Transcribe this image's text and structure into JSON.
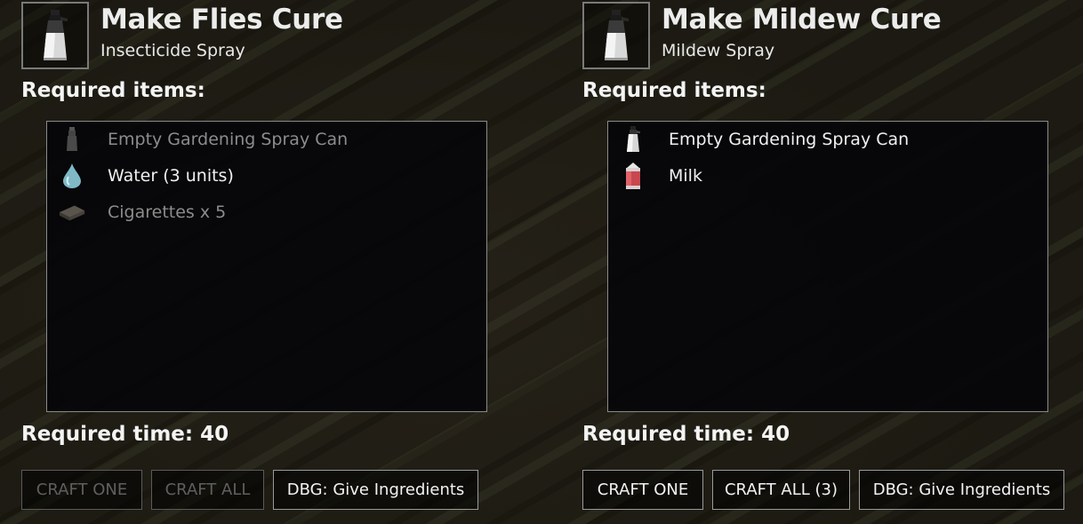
{
  "recipes": [
    {
      "title": "Make Flies Cure",
      "subtitle": "Insecticide Spray",
      "required_items_label": "Required items:",
      "items": [
        {
          "label": "Empty Gardening Spray Can",
          "icon": "spray-can-icon",
          "available": false
        },
        {
          "label": "Water (3 units)",
          "icon": "water-drop-icon",
          "available": true
        },
        {
          "label": "Cigarettes x 5",
          "icon": "cigarettes-icon",
          "available": false
        }
      ],
      "required_time_label": "Required time:",
      "required_time": "40",
      "buttons": {
        "craft_one": "CRAFT ONE",
        "craft_all": "CRAFT ALL",
        "give_ingredients": "DBG: Give Ingredients"
      },
      "craft_enabled": false
    },
    {
      "title": "Make Mildew Cure",
      "subtitle": "Mildew Spray",
      "required_items_label": "Required items:",
      "items": [
        {
          "label": "Empty Gardening Spray Can",
          "icon": "spray-can-icon",
          "available": true
        },
        {
          "label": "Milk",
          "icon": "milk-carton-icon",
          "available": true
        }
      ],
      "required_time_label": "Required time:",
      "required_time": "40",
      "buttons": {
        "craft_one": "CRAFT ONE",
        "craft_all": "CRAFT ALL (3)",
        "give_ingredients": "DBG: Give Ingredients"
      },
      "craft_enabled": true
    }
  ],
  "colors": {
    "text": "#f0f0f0",
    "text_missing": "#8c8c8c",
    "button_disabled": "#5f5f5f",
    "panel_bg": "#06060a",
    "border": "#8a8a8a"
  }
}
